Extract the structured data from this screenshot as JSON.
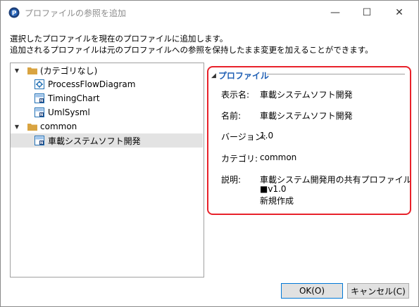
{
  "window": {
    "title": "プロファイルの参照を追加",
    "controls": {
      "minimize": "—",
      "maximize": "☐",
      "close": "✕"
    }
  },
  "description": {
    "line1": "選択したプロファイルを現在のプロファイルに追加します。",
    "line2": "追加されるプロファイルは元のプロファイルへの参照を保持したまま変更を加えることができます。"
  },
  "tree": {
    "groups": [
      {
        "label": "(カテゴリなし)",
        "expanded": true,
        "items": [
          "ProcessFlowDiagram",
          "TimingChart",
          "UmlSysml"
        ]
      },
      {
        "label": "common",
        "expanded": true,
        "items": [
          "車載システムソフト開発"
        ],
        "selected_index": 0
      }
    ]
  },
  "properties": {
    "section_label": "プロファイル",
    "rows": [
      {
        "key": "表示名:",
        "value": "車載システムソフト開発"
      },
      {
        "key": "名前:",
        "value": "車載システムソフト開発"
      },
      {
        "key": "バージョン:",
        "value": "1.0"
      },
      {
        "key": "カテゴリ:",
        "value": "common"
      },
      {
        "key": "説明:",
        "value_lines": [
          "車載システム開発用の共有プロファイル",
          "■v1.0",
          "新規作成"
        ]
      }
    ]
  },
  "buttons": {
    "ok": "OK(O)",
    "cancel": "キャンセル(C)"
  },
  "colors": {
    "accent": "#1f5fb4",
    "highlight": "#e8212a",
    "folder": "#d9a441",
    "selection": "#e3e3e3"
  }
}
